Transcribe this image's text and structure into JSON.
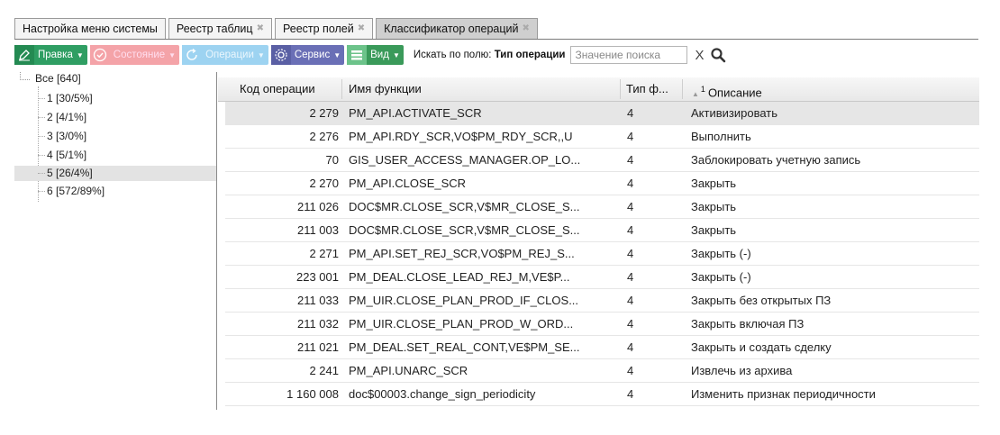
{
  "tabs": [
    {
      "label": "Настройка меню системы",
      "closable": false,
      "active": false
    },
    {
      "label": "Реестр таблиц",
      "closable": true,
      "active": false
    },
    {
      "label": "Реестр полей",
      "closable": true,
      "active": false
    },
    {
      "label": "Классификатор операций",
      "closable": true,
      "active": true
    }
  ],
  "toolbar": {
    "edit_label": "Правка",
    "state_label": "Состояние",
    "ops_label": "Операции",
    "service_label": "Сервис",
    "view_label": "Вид",
    "search_by_prefix": "Искать по полю:",
    "search_field": "Тип операции",
    "search_placeholder": "Значение поиска",
    "clear_label": "X"
  },
  "tree": {
    "root": "Все [640]",
    "items": [
      {
        "label": "1 [30/5%]",
        "selected": false
      },
      {
        "label": "2 [4/1%]",
        "selected": false
      },
      {
        "label": "3 [3/0%]",
        "selected": false
      },
      {
        "label": "4 [5/1%]",
        "selected": false
      },
      {
        "label": "5 [26/4%]",
        "selected": true
      },
      {
        "label": "6 [572/89%]",
        "selected": false
      }
    ]
  },
  "grid": {
    "columns": {
      "code": "Код операции",
      "func": "Имя функции",
      "type": "Тип ф...",
      "sort_order": "1",
      "desc": "Описание"
    },
    "rows": [
      {
        "code": "2 279",
        "func": "PM_API.ACTIVATE_SCR",
        "type": "4",
        "desc": "Активизировать",
        "selected": true
      },
      {
        "code": "2 276",
        "func": "PM_API.RDY_SCR,VO$PM_RDY_SCR,,U",
        "type": "4",
        "desc": "Выполнить",
        "selected": false
      },
      {
        "code": "70",
        "func": "GIS_USER_ACCESS_MANAGER.OP_LO...",
        "type": "4",
        "desc": "Заблокировать учетную запись",
        "selected": false
      },
      {
        "code": "2 270",
        "func": "PM_API.CLOSE_SCR",
        "type": "4",
        "desc": "Закрыть",
        "selected": false
      },
      {
        "code": "211 026",
        "func": "DOC$MR.CLOSE_SCR,V$MR_CLOSE_S...",
        "type": "4",
        "desc": "Закрыть",
        "selected": false
      },
      {
        "code": "211 003",
        "func": "DOC$MR.CLOSE_SCR,V$MR_CLOSE_S...",
        "type": "4",
        "desc": "Закрыть",
        "selected": false
      },
      {
        "code": "2 271",
        "func": "PM_API.SET_REJ_SCR,VO$PM_REJ_S...",
        "type": "4",
        "desc": "Закрыть (-)",
        "selected": false
      },
      {
        "code": "223 001",
        "func": "PM_DEAL.CLOSE_LEAD_REJ_M,VE$P...",
        "type": "4",
        "desc": "Закрыть (-)",
        "selected": false
      },
      {
        "code": "211 033",
        "func": "PM_UIR.CLOSE_PLAN_PROD_IF_CLOS...",
        "type": "4",
        "desc": "Закрыть без открытых ПЗ",
        "selected": false
      },
      {
        "code": "211 032",
        "func": "PM_UIR.CLOSE_PLAN_PROD_W_ORD...",
        "type": "4",
        "desc": "Закрыть включая ПЗ",
        "selected": false
      },
      {
        "code": "211 021",
        "func": "PM_DEAL.SET_REAL_CONT,VE$PM_SE...",
        "type": "4",
        "desc": "Закрыть и создать сделку",
        "selected": false
      },
      {
        "code": "2 241",
        "func": "PM_API.UNARC_SCR",
        "type": "4",
        "desc": "Извлечь из архива",
        "selected": false
      },
      {
        "code": "1 160 008",
        "func": "doc$00003.change_sign_periodicity",
        "type": "4",
        "desc": "Изменить признак периодичности",
        "selected": false
      }
    ]
  }
}
